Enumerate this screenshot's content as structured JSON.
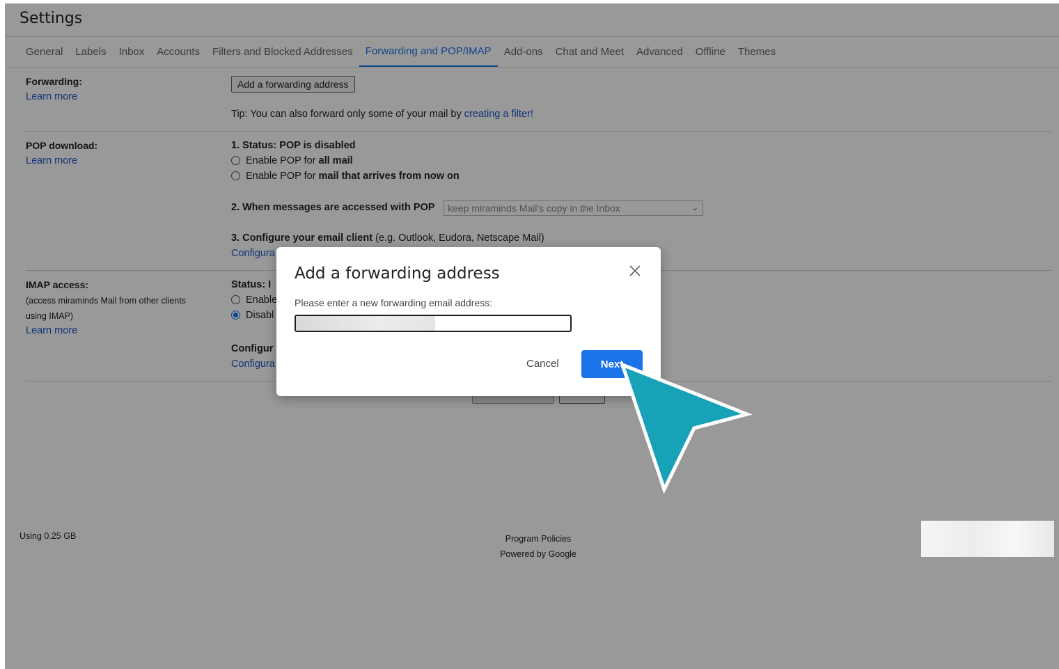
{
  "header": {
    "title": "Settings"
  },
  "tabs": [
    {
      "label": "General"
    },
    {
      "label": "Labels"
    },
    {
      "label": "Inbox"
    },
    {
      "label": "Accounts"
    },
    {
      "label": "Filters and Blocked Addresses"
    },
    {
      "label": "Forwarding and POP/IMAP",
      "active": true
    },
    {
      "label": "Add-ons"
    },
    {
      "label": "Chat and Meet"
    },
    {
      "label": "Advanced"
    },
    {
      "label": "Offline"
    },
    {
      "label": "Themes"
    }
  ],
  "forwarding": {
    "label": "Forwarding:",
    "learn_more": "Learn more",
    "add_button": "Add a forwarding address",
    "tip_prefix": "Tip: You can also forward only some of your mail by ",
    "tip_link": "creating a filter!"
  },
  "pop": {
    "label": "POP download:",
    "learn_more": "Learn more",
    "status": "1. Status: POP is disabled",
    "opt1_prefix": "Enable POP for ",
    "opt1_bold": "all mail",
    "opt2_prefix": "Enable POP for ",
    "opt2_bold": "mail that arrives from now on",
    "when_label": "2. When messages are accessed with POP",
    "when_select": "keep miraminds Mail's copy in the Inbox",
    "configure_bold": "3. Configure your email client",
    "configure_rest": " (e.g. Outlook, Eudora, Netscape Mail)",
    "configure_link": "Configura"
  },
  "imap": {
    "label": "IMAP access:",
    "desc_line1": "(access miraminds Mail from other clients",
    "desc_line2": "using IMAP)",
    "learn_more": "Learn more",
    "status": "Status: I",
    "opt1": "Enable",
    "opt2": "Disabl",
    "configure_bold": "Configur",
    "configure_link": "Configura"
  },
  "footer": {
    "storage": "Using 0.25 GB",
    "policies": "Program Policies",
    "powered": "Powered by Google"
  },
  "dialog": {
    "title": "Add a forwarding address",
    "prompt": "Please enter a new forwarding email address:",
    "input_value": "",
    "cancel": "Cancel",
    "next": "Next"
  },
  "icons": {
    "close": "close-icon",
    "pointer": "cursor-arrow-icon"
  },
  "colors": {
    "accent": "#1a73e8",
    "link": "#1a56c9",
    "pointer": "#17a2b8"
  }
}
